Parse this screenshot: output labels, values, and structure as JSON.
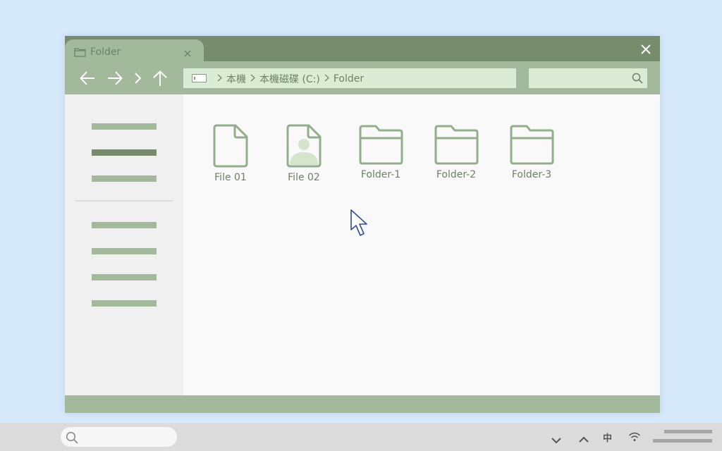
{
  "window": {
    "tab": {
      "title": "Folder",
      "icon": "folder-icon"
    },
    "close_icon": "close-icon"
  },
  "navigation": {
    "back_icon": "arrow-left-icon",
    "forward_icon": "arrow-right-icon",
    "recent_icon": "chevron-right-icon",
    "up_icon": "arrow-up-icon"
  },
  "address_bar": {
    "drive_icon": "drive-icon",
    "breadcrumbs": [
      "本機",
      "本機磁碟 (C:)",
      "Folder"
    ]
  },
  "search": {
    "icon": "search-icon"
  },
  "files": [
    {
      "label": "File 01",
      "icon": "file-icon"
    },
    {
      "label": "File 02",
      "icon": "image-file-icon"
    },
    {
      "label": "Folder-1",
      "icon": "folder-icon"
    },
    {
      "label": "Folder-2",
      "icon": "folder-icon"
    },
    {
      "label": "Folder-3",
      "icon": "folder-icon"
    }
  ],
  "taskbar": {
    "search_icon": "search-icon",
    "tray": {
      "expand_icon": "chevron-down-icon",
      "show_hidden_icon": "chevron-up-icon",
      "ime_label": "中",
      "wifi_icon": "wifi-icon"
    }
  },
  "colors": {
    "accent": "#a3b99b",
    "accent_dark": "#778c6d",
    "icon_stroke": "#93ae8a",
    "text": "#6e8067",
    "desktop": "#d6eafb",
    "cursor": "#2f4f9a"
  }
}
